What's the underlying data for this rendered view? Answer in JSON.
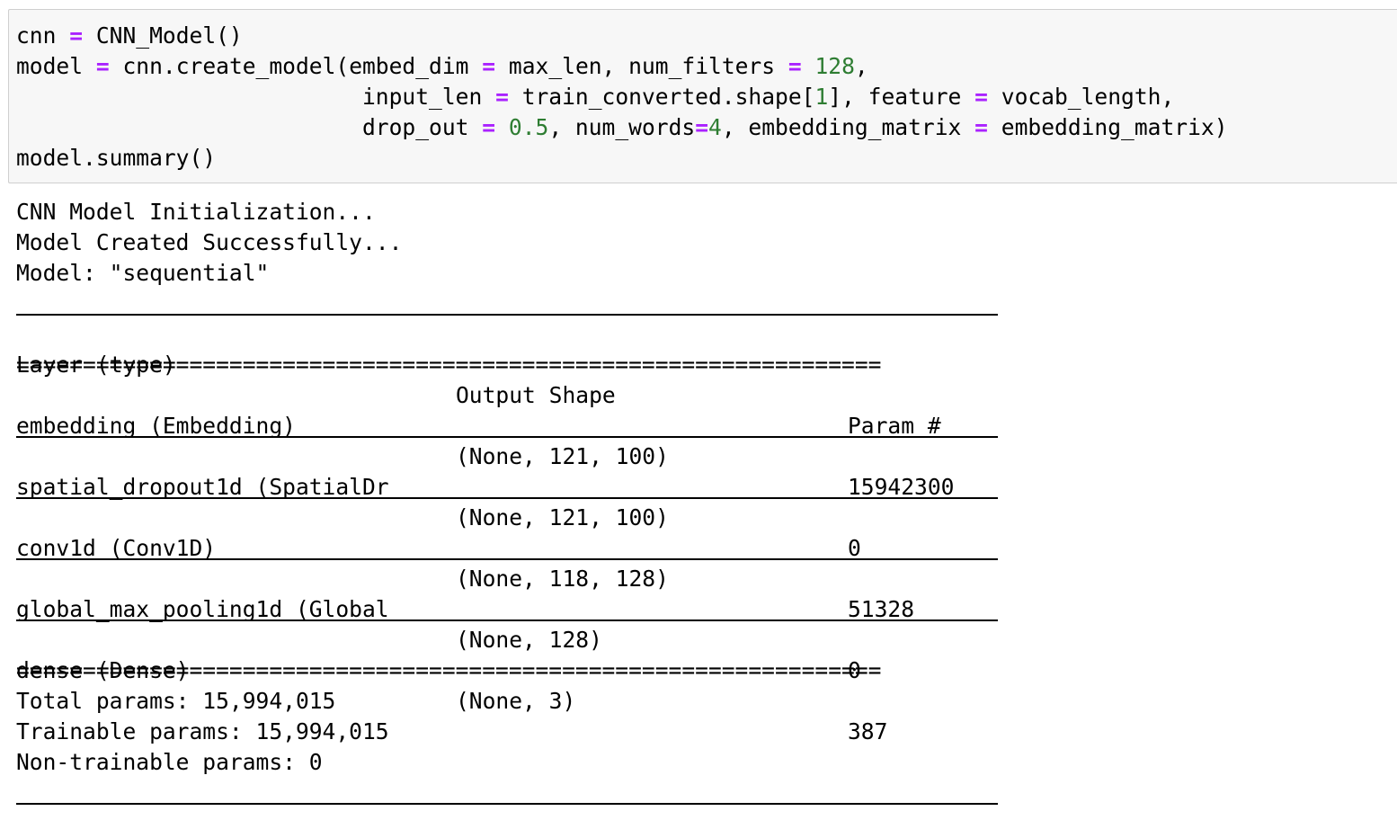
{
  "code": {
    "line1": {
      "v1": "cnn",
      "op1": "=",
      "t1": "CNN_Model()"
    },
    "line2": {
      "v1": "model",
      "op1": "=",
      "t1": "cnn.create_model(embed_dim",
      "op2": "=",
      "t2": "max_len, num_filters",
      "op3": "=",
      "n1": "128",
      "t3": ","
    },
    "line3": {
      "t1": "input_len",
      "op1": "=",
      "t2": "train_converted.shape[",
      "n1": "1",
      "t3": "], feature",
      "op2": "=",
      "t4": "vocab_length,"
    },
    "line4": {
      "t1": "drop_out",
      "op1": "=",
      "n1": "0.5",
      "t2": ", num_words",
      "op2": "=",
      "n2": "4",
      "t3": ", embedding_matrix",
      "op3": "=",
      "t4": "embedding_matrix)"
    },
    "line5": {
      "t1": "model.summary()"
    }
  },
  "output": {
    "messages": [
      "CNN Model Initialization...",
      "Model Created Successfully...",
      "Model: \"sequential\""
    ],
    "rule_char": "_",
    "double_rule": "=================================================================",
    "headers": {
      "layer": "Layer (type)",
      "shape": "Output Shape",
      "param": "Param #"
    },
    "rows": [
      {
        "layer": "embedding (Embedding)",
        "shape": "(None, 121, 100)",
        "param": "15942300"
      },
      {
        "layer": "spatial_dropout1d (SpatialDr",
        "shape": "(None, 121, 100)",
        "param": "0"
      },
      {
        "layer": "conv1d (Conv1D)",
        "shape": "(None, 118, 128)",
        "param": "51328"
      },
      {
        "layer": "global_max_pooling1d (Global",
        "shape": "(None, 128)",
        "param": "0"
      },
      {
        "layer": "dense (Dense)",
        "shape": "(None, 3)",
        "param": "387"
      }
    ],
    "totals": [
      "Total params: 15,994,015",
      "Trainable params: 15,994,015",
      "Non-trainable params: 0"
    ]
  },
  "colors": {
    "operator": "#aa22ff",
    "number": "#2e7d32",
    "cell_background": "#f7f7f7"
  }
}
